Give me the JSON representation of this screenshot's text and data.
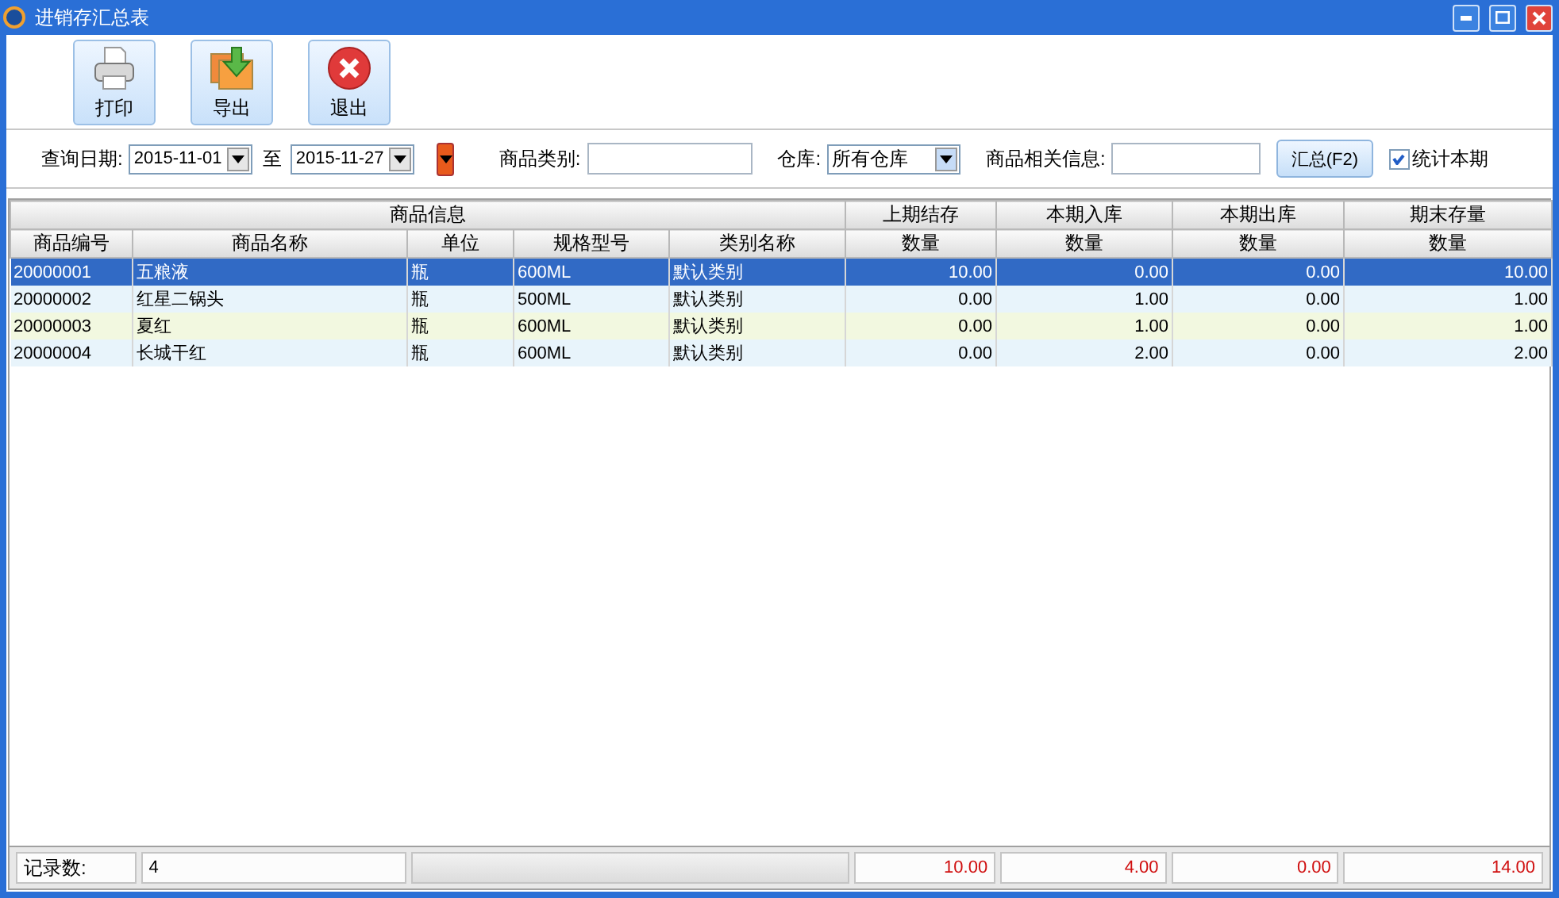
{
  "window": {
    "title": "进销存汇总表"
  },
  "toolbar": [
    {
      "kind": "print",
      "label": "打印"
    },
    {
      "kind": "export",
      "label": "导出"
    },
    {
      "kind": "exit",
      "label": "退出"
    }
  ],
  "filters": {
    "date_label": "查询日期:",
    "date_from": "2015-11-01",
    "to_label": "至",
    "date_to": "2015-11-27",
    "category_label": "商品类别:",
    "warehouse_label": "仓库:",
    "warehouse": "所有仓库",
    "info_label": "商品相关信息:",
    "summary_button": "汇总(F2)",
    "current_period": {
      "label": "统计本期",
      "checked": true
    }
  },
  "table": {
    "groups": [
      "商品信息",
      "上期结存",
      "本期入库",
      "本期出库",
      "期末存量"
    ],
    "columns": [
      "商品编号",
      "商品名称",
      "单位",
      "规格型号",
      "类别名称",
      "数量",
      "数量",
      "数量",
      "数量"
    ],
    "rows": [
      {
        "selected": true,
        "cells": [
          "20000001",
          "五粮液",
          "瓶",
          "600ML",
          "默认类别",
          "10.00",
          "0.00",
          "0.00",
          "10.00"
        ]
      },
      {
        "selected": false,
        "cells": [
          "20000002",
          "红星二锅头",
          "瓶",
          "500ML",
          "默认类别",
          "0.00",
          "1.00",
          "0.00",
          "1.00"
        ]
      },
      {
        "selected": false,
        "cells": [
          "20000003",
          "夏红",
          "瓶",
          "600ML",
          "默认类别",
          "0.00",
          "1.00",
          "0.00",
          "1.00"
        ]
      },
      {
        "selected": false,
        "cells": [
          "20000004",
          "长城干红",
          "瓶",
          "600ML",
          "默认类别",
          "0.00",
          "2.00",
          "0.00",
          "2.00"
        ]
      }
    ]
  },
  "footer": {
    "count_label": "记录数:",
    "count": "4",
    "totals": [
      "10.00",
      "4.00",
      "0.00",
      "14.00"
    ]
  }
}
